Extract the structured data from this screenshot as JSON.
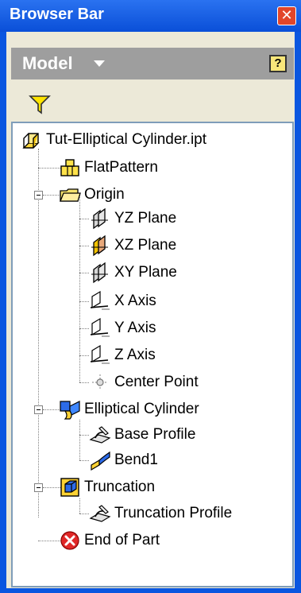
{
  "window": {
    "title": "Browser Bar",
    "close_symbol": "✕"
  },
  "model_bar": {
    "label": "Model",
    "help_symbol": "?"
  },
  "tree": {
    "root": {
      "label": "Tut-Elliptical Cylinder.ipt",
      "icon": "part-icon"
    },
    "items": [
      {
        "label": "FlatPattern",
        "icon": "flat-pattern-icon"
      },
      {
        "label": "Origin",
        "icon": "folder-icon"
      },
      {
        "label": "YZ Plane",
        "icon": "plane-icon"
      },
      {
        "label": "XZ Plane",
        "icon": "plane-highlighted-icon"
      },
      {
        "label": "XY Plane",
        "icon": "plane-icon"
      },
      {
        "label": "X Axis",
        "icon": "axis-icon"
      },
      {
        "label": "Y Axis",
        "icon": "axis-icon"
      },
      {
        "label": "Z Axis",
        "icon": "axis-icon"
      },
      {
        "label": "Center Point",
        "icon": "center-point-icon"
      },
      {
        "label": "Elliptical Cylinder",
        "icon": "sheet-metal-face-icon"
      },
      {
        "label": "Base Profile",
        "icon": "sketch-icon"
      },
      {
        "label": "Bend1",
        "icon": "bend-icon"
      },
      {
        "label": "Truncation",
        "icon": "cut-feature-icon"
      },
      {
        "label": "Truncation Profile",
        "icon": "sketch-icon"
      },
      {
        "label": "End of Part",
        "icon": "end-of-part-icon"
      }
    ]
  },
  "colors": {
    "titlebar": "#0a56e0",
    "panel": "#ece9d8",
    "model_bar": "#9e9e9e",
    "tree_border": "#7f9db9"
  }
}
